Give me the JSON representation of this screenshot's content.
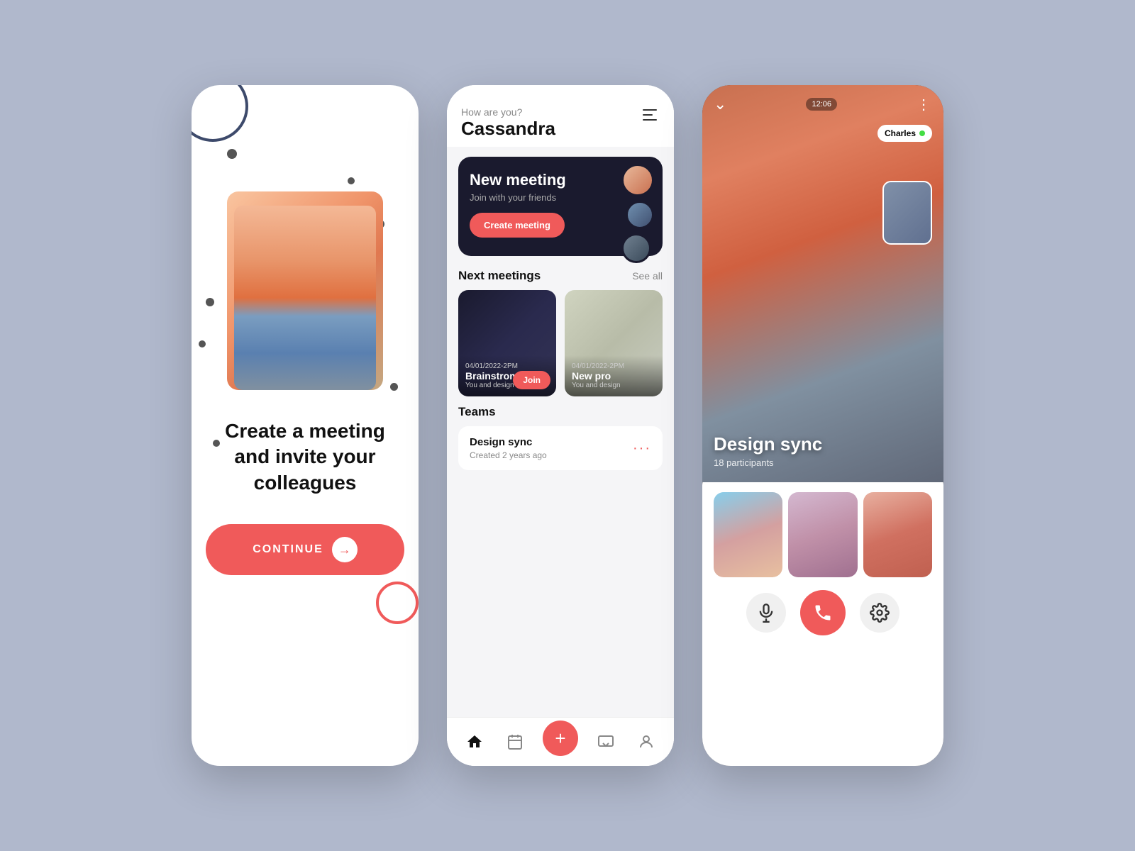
{
  "bg_color": "#b0b8cc",
  "phone1": {
    "heading_line1": "Create a meeting",
    "heading_line2": "and invite your",
    "heading_line3": "colleagues",
    "continue_label": "CONTINUE"
  },
  "phone2": {
    "greeting_small": "How are you?",
    "greeting_name": "Cassandra",
    "banner": {
      "title": "New meeting",
      "subtitle": "Join with your friends",
      "create_button": "Create meeting"
    },
    "next_meetings": {
      "section_title": "Next meetings",
      "see_all": "See all",
      "meetings": [
        {
          "date": "04/01/2022-2PM",
          "title": "Brainstrom",
          "sub": "You and design team",
          "join_label": "Join"
        },
        {
          "date": "04/01/2022-2PM",
          "title": "New pro",
          "sub": "You and design"
        }
      ]
    },
    "teams": {
      "section_title": "Teams",
      "items": [
        {
          "name": "Design sync",
          "sub": "Created 2 years ago"
        }
      ]
    }
  },
  "phone3": {
    "call_time": "12:06",
    "charles_name": "Charles",
    "meeting_name": "Design sync",
    "participants": "18 participants",
    "more_dots": "⋮",
    "controls": {
      "mic_label": "microphone",
      "end_label": "end call",
      "settings_label": "settings"
    }
  }
}
